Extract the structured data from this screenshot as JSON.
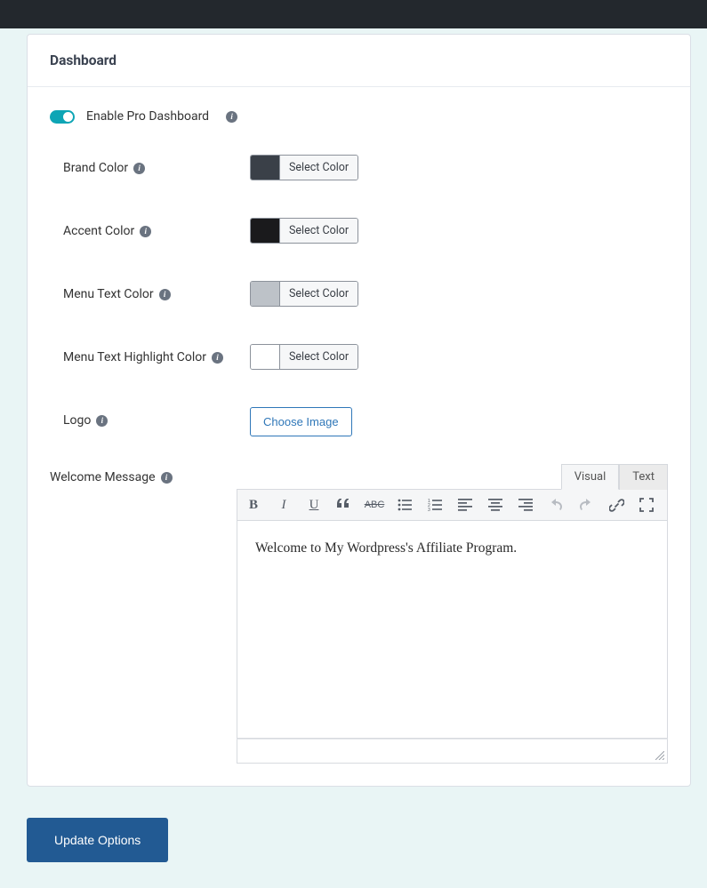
{
  "panel": {
    "title": "Dashboard"
  },
  "toggle": {
    "label": "Enable Pro Dashboard",
    "on": true
  },
  "colors": {
    "brand": {
      "label": "Brand Color",
      "swatch": "#3a4048",
      "button": "Select Color"
    },
    "accent": {
      "label": "Accent Color",
      "swatch": "#1a1a1c",
      "button": "Select Color"
    },
    "menuText": {
      "label": "Menu Text Color",
      "swatch": "#bdc2c8",
      "button": "Select Color"
    },
    "menuHi": {
      "label": "Menu Text Highlight Color",
      "swatch": "#ffffff",
      "button": "Select Color"
    }
  },
  "logo": {
    "label": "Logo",
    "button": "Choose Image"
  },
  "message": {
    "label": "Welcome Message",
    "content": "Welcome to My Wordpress's Affiliate Program.",
    "tabs": {
      "visual": "Visual",
      "text": "Text",
      "active": "visual"
    }
  },
  "submit": {
    "label": "Update Options"
  }
}
